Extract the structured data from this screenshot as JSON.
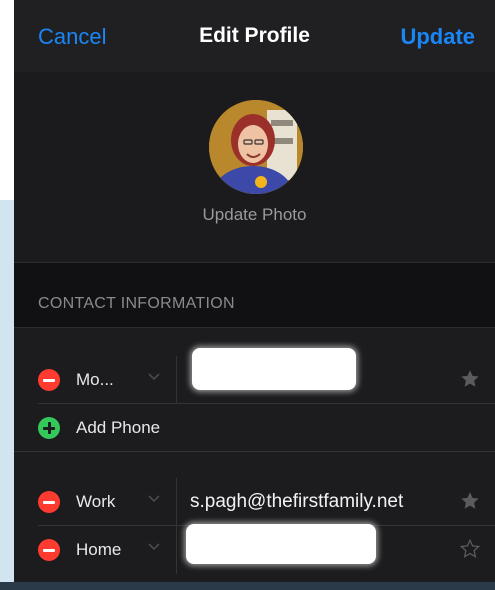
{
  "nav": {
    "cancel_label": "Cancel",
    "title": "Edit Profile",
    "update_label": "Update"
  },
  "photo": {
    "update_label": "Update Photo"
  },
  "section": {
    "contact_header": "CONTACT INFORMATION"
  },
  "phones": [
    {
      "type": "Mo...",
      "value": "",
      "favorite": true
    }
  ],
  "add_phone_label": "Add Phone",
  "emails": [
    {
      "type": "Work",
      "value": "s.pagh@thefirstfamily.net",
      "favorite": true
    },
    {
      "type": "Home",
      "value": "",
      "favorite": false
    }
  ],
  "colors": {
    "accent": "#1a86f5",
    "delete": "#ff3b30",
    "add": "#34c759",
    "background": "#1c1c1e"
  }
}
